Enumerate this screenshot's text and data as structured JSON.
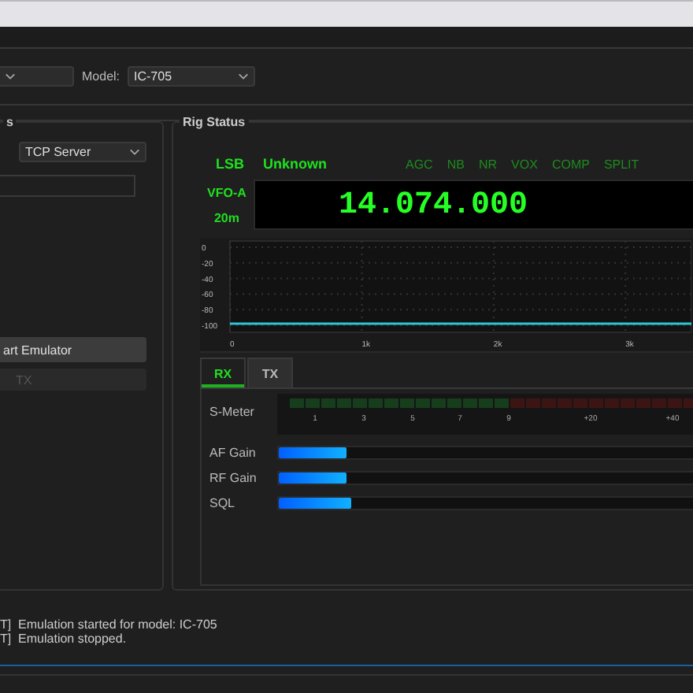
{
  "toolbar": {
    "model_label": "Model:",
    "model": {
      "value": "IC-705"
    }
  },
  "left_group": {
    "title": "s",
    "connection": {
      "value": "TCP Server"
    },
    "start_button": "art Emulator",
    "tx_button": {
      "label": "TX",
      "disabled": true
    }
  },
  "rig_status": {
    "title": "Rig Status",
    "mode": "LSB",
    "status": "Unknown",
    "indicators": [
      {
        "label": "AGC",
        "on": false
      },
      {
        "label": "NB",
        "on": false
      },
      {
        "label": "NR",
        "on": false
      },
      {
        "label": "VOX",
        "on": false
      },
      {
        "label": "COMP",
        "on": false
      },
      {
        "label": "SPLIT",
        "on": false
      }
    ],
    "vfo": "VFO-A",
    "band": "20m",
    "frequency": "14.074.000",
    "spectrum": {
      "chart_data": {
        "type": "line",
        "x": [
          0,
          3500
        ],
        "series": [
          {
            "color": "#2ec4d6",
            "values": [
              -98,
              -98
            ]
          }
        ],
        "grid": true,
        "xlim": [
          0,
          3500
        ],
        "ylim": [
          -105,
          0
        ],
        "xticks": [
          {
            "value": 0,
            "label": "0"
          },
          {
            "value": 1000,
            "label": "1k"
          },
          {
            "value": 2000,
            "label": "2k"
          },
          {
            "value": 3000,
            "label": "3k"
          }
        ],
        "yticks": [
          0,
          -20,
          -40,
          -60,
          -80,
          -100
        ]
      }
    },
    "tabs": [
      {
        "label": "RX",
        "selected": true
      },
      {
        "label": "TX",
        "selected": false
      }
    ],
    "s_meter": {
      "label": "S-Meter",
      "level": 0,
      "scale": [
        "1",
        "3",
        "5",
        "7",
        "9",
        "+20",
        "+40"
      ]
    },
    "sliders": [
      {
        "label": "AF Gain",
        "level": 0.16
      },
      {
        "label": "RF Gain",
        "level": 0.16
      },
      {
        "label": "SQL",
        "level": 0.17
      }
    ]
  },
  "log": [
    "T]  Emulation started for model: IC-705",
    "T]  Emulation stopped."
  ]
}
